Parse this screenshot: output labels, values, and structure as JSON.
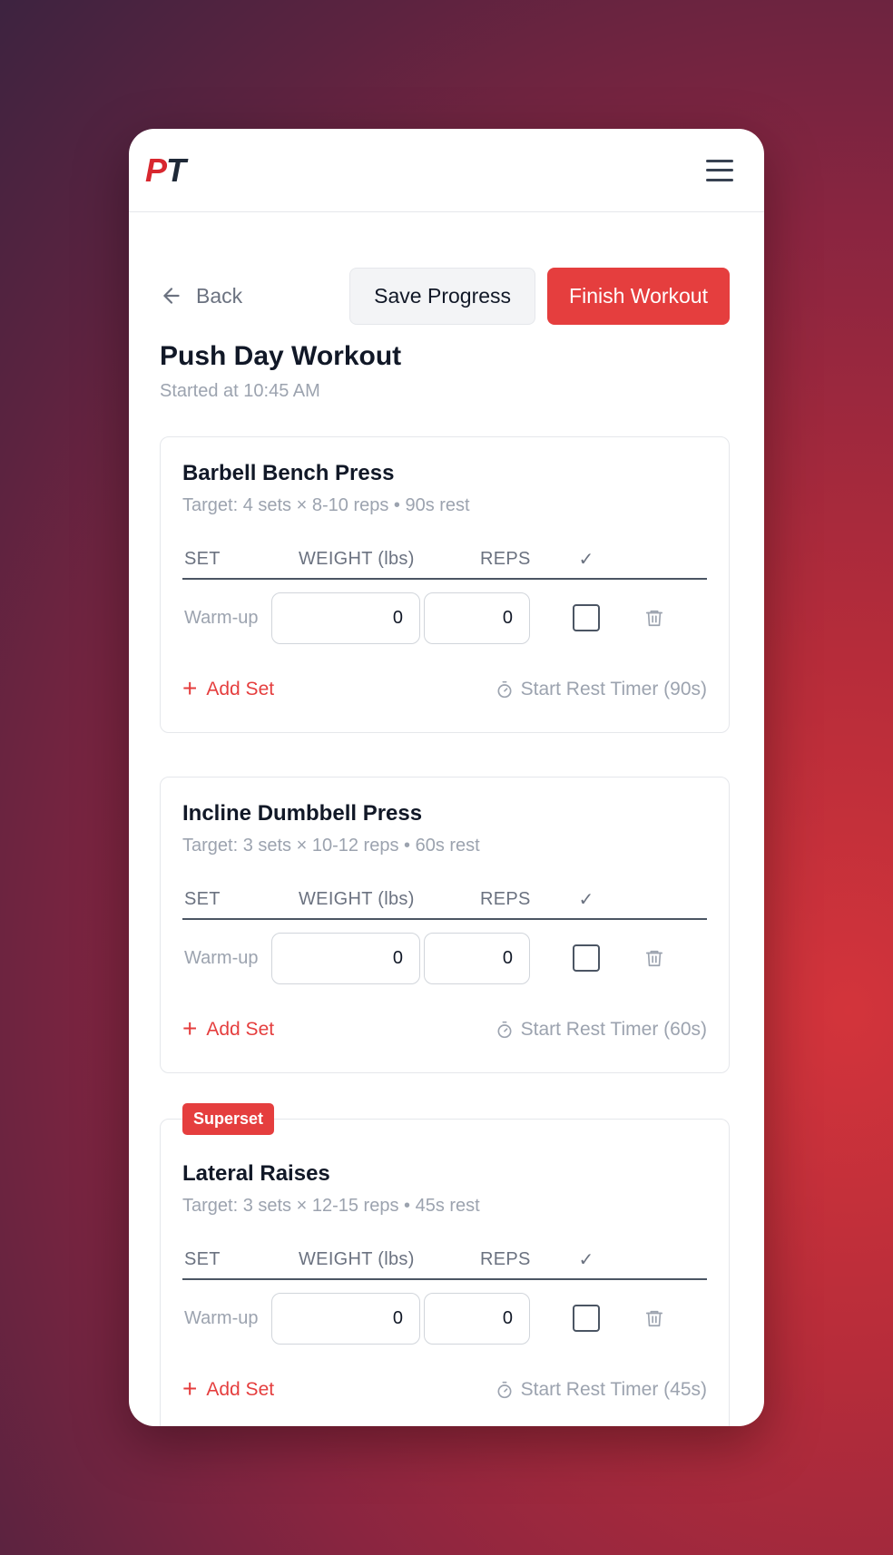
{
  "app": {
    "logo_p": "P",
    "logo_t": "T",
    "menu_icon": "hamburger-menu-icon"
  },
  "header": {
    "back_label": "Back",
    "save_label": "Save Progress",
    "finish_label": "Finish Workout"
  },
  "workout": {
    "title": "Push Day Workout",
    "started": "Started at 10:45 AM"
  },
  "columns": {
    "set": "SET",
    "weight": "WEIGHT (lbs)",
    "reps": "REPS",
    "check": "✓"
  },
  "exercises": [
    {
      "name": "Barbell Bench Press",
      "target": "Target: 4 sets × 8-10 reps • 90s rest",
      "set_label": "Warm-up",
      "weight": "0",
      "reps": "0",
      "add_set": "Add Set",
      "timer": "Start Rest Timer (90s)"
    },
    {
      "name": "Incline Dumbbell Press",
      "target": "Target: 3 sets × 10-12 reps • 60s rest",
      "set_label": "Warm-up",
      "weight": "0",
      "reps": "0",
      "add_set": "Add Set",
      "timer": "Start Rest Timer (60s)"
    },
    {
      "badge": "Superset",
      "name": "Lateral Raises",
      "target": "Target: 3 sets × 12-15 reps • 45s rest",
      "set_label": "Warm-up",
      "weight": "0",
      "reps": "0",
      "add_set": "Add Set",
      "timer": "Start Rest Timer (45s)"
    }
  ],
  "colors": {
    "accent": "#e53e3e",
    "text": "#111827",
    "muted": "#9ca3af"
  }
}
